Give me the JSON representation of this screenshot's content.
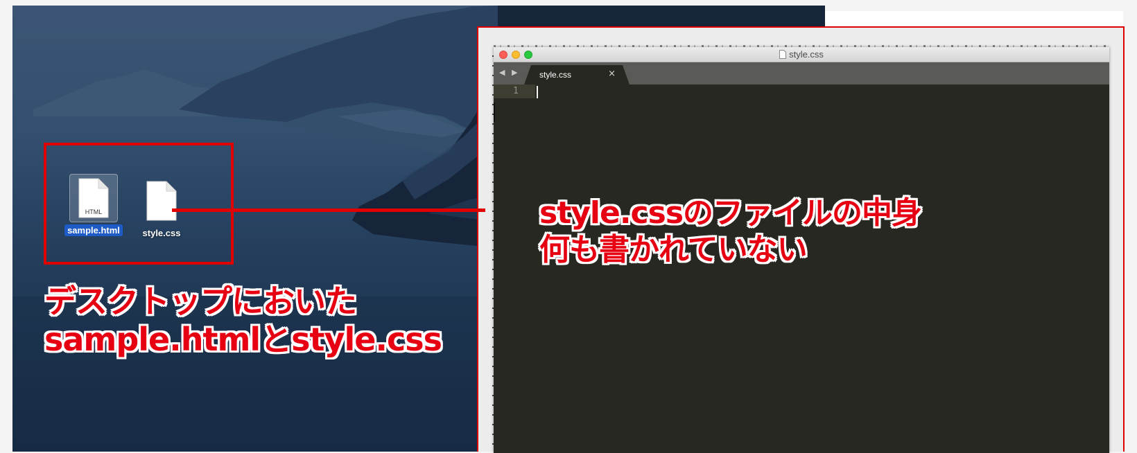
{
  "desktop": {
    "files": [
      {
        "name": "sample.html",
        "icon": "html-file-icon",
        "badge": "HTML",
        "selected": true
      },
      {
        "name": "style.css",
        "icon": "css-file-icon",
        "selected": false
      }
    ],
    "annotation": {
      "line1": "デスクトップにおいた",
      "line2": "sample.htmlとstyle.css"
    }
  },
  "editor": {
    "window_title": "style.css",
    "tabs": [
      {
        "label": "style.css",
        "close": "×"
      }
    ],
    "nav_arrows": "◀ ▶",
    "lines": [
      {
        "number": "1",
        "text": ""
      }
    ],
    "annotation": {
      "line1": "style.cssのファイルの中身",
      "line2": "何も書かれていない"
    }
  },
  "colors": {
    "annotation": "#e60012",
    "selection": "#1e5bc6",
    "editor_bg": "#272822"
  }
}
